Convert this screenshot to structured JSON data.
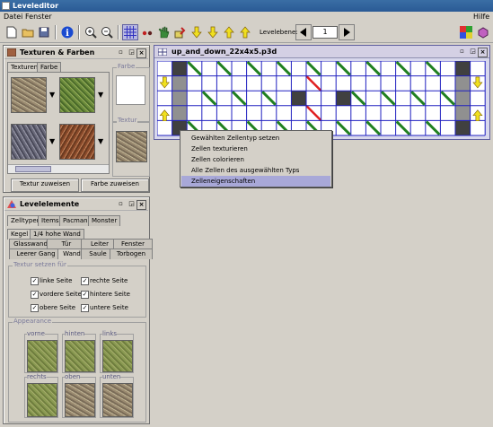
{
  "window": {
    "title": "Leveleditor"
  },
  "menu": {
    "items": [
      "Datei",
      "Fenster"
    ],
    "help": "Hilfe"
  },
  "toolbar": {
    "level_label": "Levelebene:",
    "level_value": "1",
    "icons": [
      "new-file-icon",
      "open-folder-icon",
      "save-icon",
      "info-icon",
      "zoom-in-icon",
      "zoom-out-icon",
      "grid-icon",
      "select-icon",
      "hand-icon",
      "paint-icon",
      "arrow-down-icon",
      "arrow-down-icon",
      "arrow-up-icon",
      "arrow-up-icon"
    ]
  },
  "texture_panel": {
    "title": "Texturen & Farben",
    "tabs": [
      "Texturen",
      "Farbe"
    ],
    "color_group": "Farbe",
    "texture_group": "Textur",
    "assign_texture": "Textur zuweisen",
    "assign_color": "Farbe zuweisen"
  },
  "level_elements": {
    "title": "Levelelemente",
    "tabs": [
      "Zelltypen",
      "Items",
      "Pacman",
      "Monster"
    ],
    "subtabs": [
      "Kegel",
      "1/4 hohe Wand"
    ],
    "subtabs2": [
      "Glasswand",
      "Tür",
      "Leiter",
      "Fenster"
    ],
    "subtabs3": [
      "Leerer Gang",
      "Wand",
      "Saule",
      "Torbogen"
    ],
    "texture_group": "Textur setzen für",
    "checkboxes": [
      "linke Seite",
      "rechte Seite",
      "vordere Seite",
      "hintere Seite",
      "obere Seite",
      "untere Seite"
    ],
    "appearance_group": "Appearance",
    "faces": [
      "vorne",
      "hinten",
      "links",
      "rechts",
      "oben",
      "unten"
    ]
  },
  "map_window": {
    "title": "up_and_down_22x4x5.p3d"
  },
  "context_menu": {
    "items": [
      "Gewählten Zellentyp setzen",
      "Zellen texturieren",
      "Zellen colorieren",
      "Alle Zellen des ausgewählten Typs selektieren",
      "Zelleneigenschaften"
    ],
    "highlighted_index": 4
  },
  "colors": {
    "grid_line": "#2020c0",
    "diagonal": "#208020",
    "red_line": "#e02020",
    "wall": "#404040",
    "arrow": "#f0e020",
    "highlight": "#a8a8d8"
  }
}
